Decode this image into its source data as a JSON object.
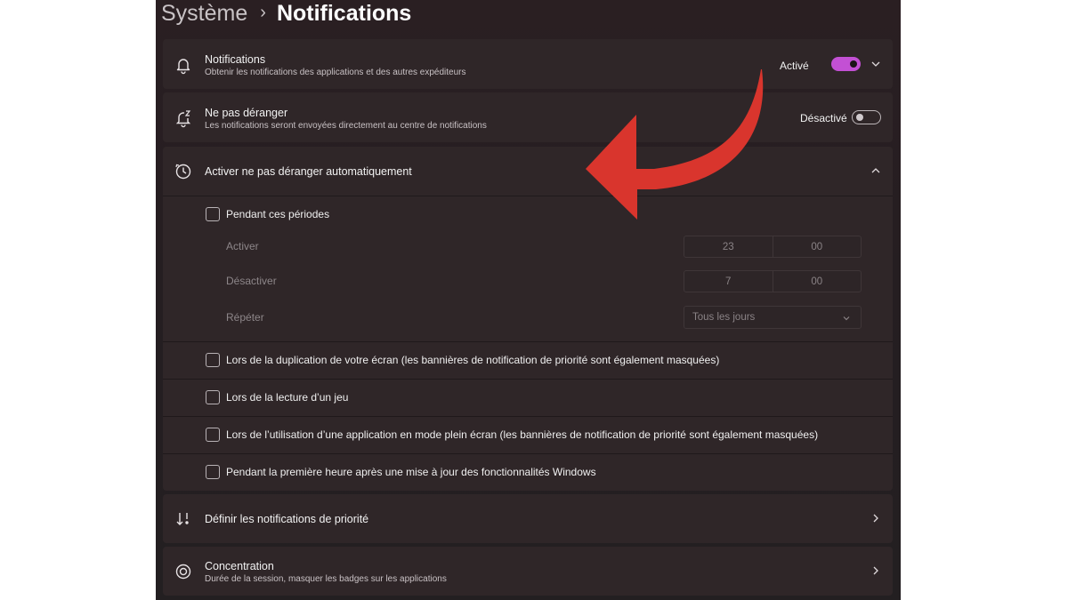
{
  "breadcrumb": {
    "parent": "Système",
    "separator": "›",
    "current": "Notifications"
  },
  "notifications": {
    "title": "Notifications",
    "subtitle": "Obtenir les notifications des applications et des autres expéditeurs",
    "state": "Activé",
    "toggle_on": true,
    "icon": "bell-icon"
  },
  "dnd": {
    "title": "Ne pas déranger",
    "subtitle": "Les notifications seront envoyées directement au centre de notifications",
    "state": "Désactivé",
    "toggle_on": false,
    "icon": "bell-snooze-icon"
  },
  "auto_dnd": {
    "title": "Activer ne pas déranger automatiquement",
    "icon": "clock-icon",
    "periods": {
      "label": "Pendant ces périodes",
      "checked": false,
      "on_label": "Activer",
      "on_hour": "23",
      "on_minute": "00",
      "off_label": "Désactiver",
      "off_hour": "7",
      "off_minute": "00",
      "repeat_label": "Répéter",
      "repeat_value": "Tous les jours"
    },
    "options": [
      {
        "label": "Lors de la duplication de votre écran (les bannières de notification de priorité sont également masquées)",
        "checked": false
      },
      {
        "label": "Lors de la lecture d’un jeu",
        "checked": false
      },
      {
        "label": "Lors de l’utilisation d’une application en mode plein écran (les bannières de notification de priorité sont également masquées)",
        "checked": false
      },
      {
        "label": "Pendant la première heure après une mise à jour des fonctionnalités Windows",
        "checked": false
      }
    ]
  },
  "priority": {
    "title": "Définir les notifications de priorité",
    "icon": "priority-sort-icon"
  },
  "focus": {
    "title": "Concentration",
    "subtitle": "Durée de la session, masquer les badges sur les applications",
    "icon": "focus-icon"
  },
  "colors": {
    "accent": "#c350d4",
    "arrow": "#d9352d",
    "card": "#2f2628",
    "background": "#251e21"
  }
}
